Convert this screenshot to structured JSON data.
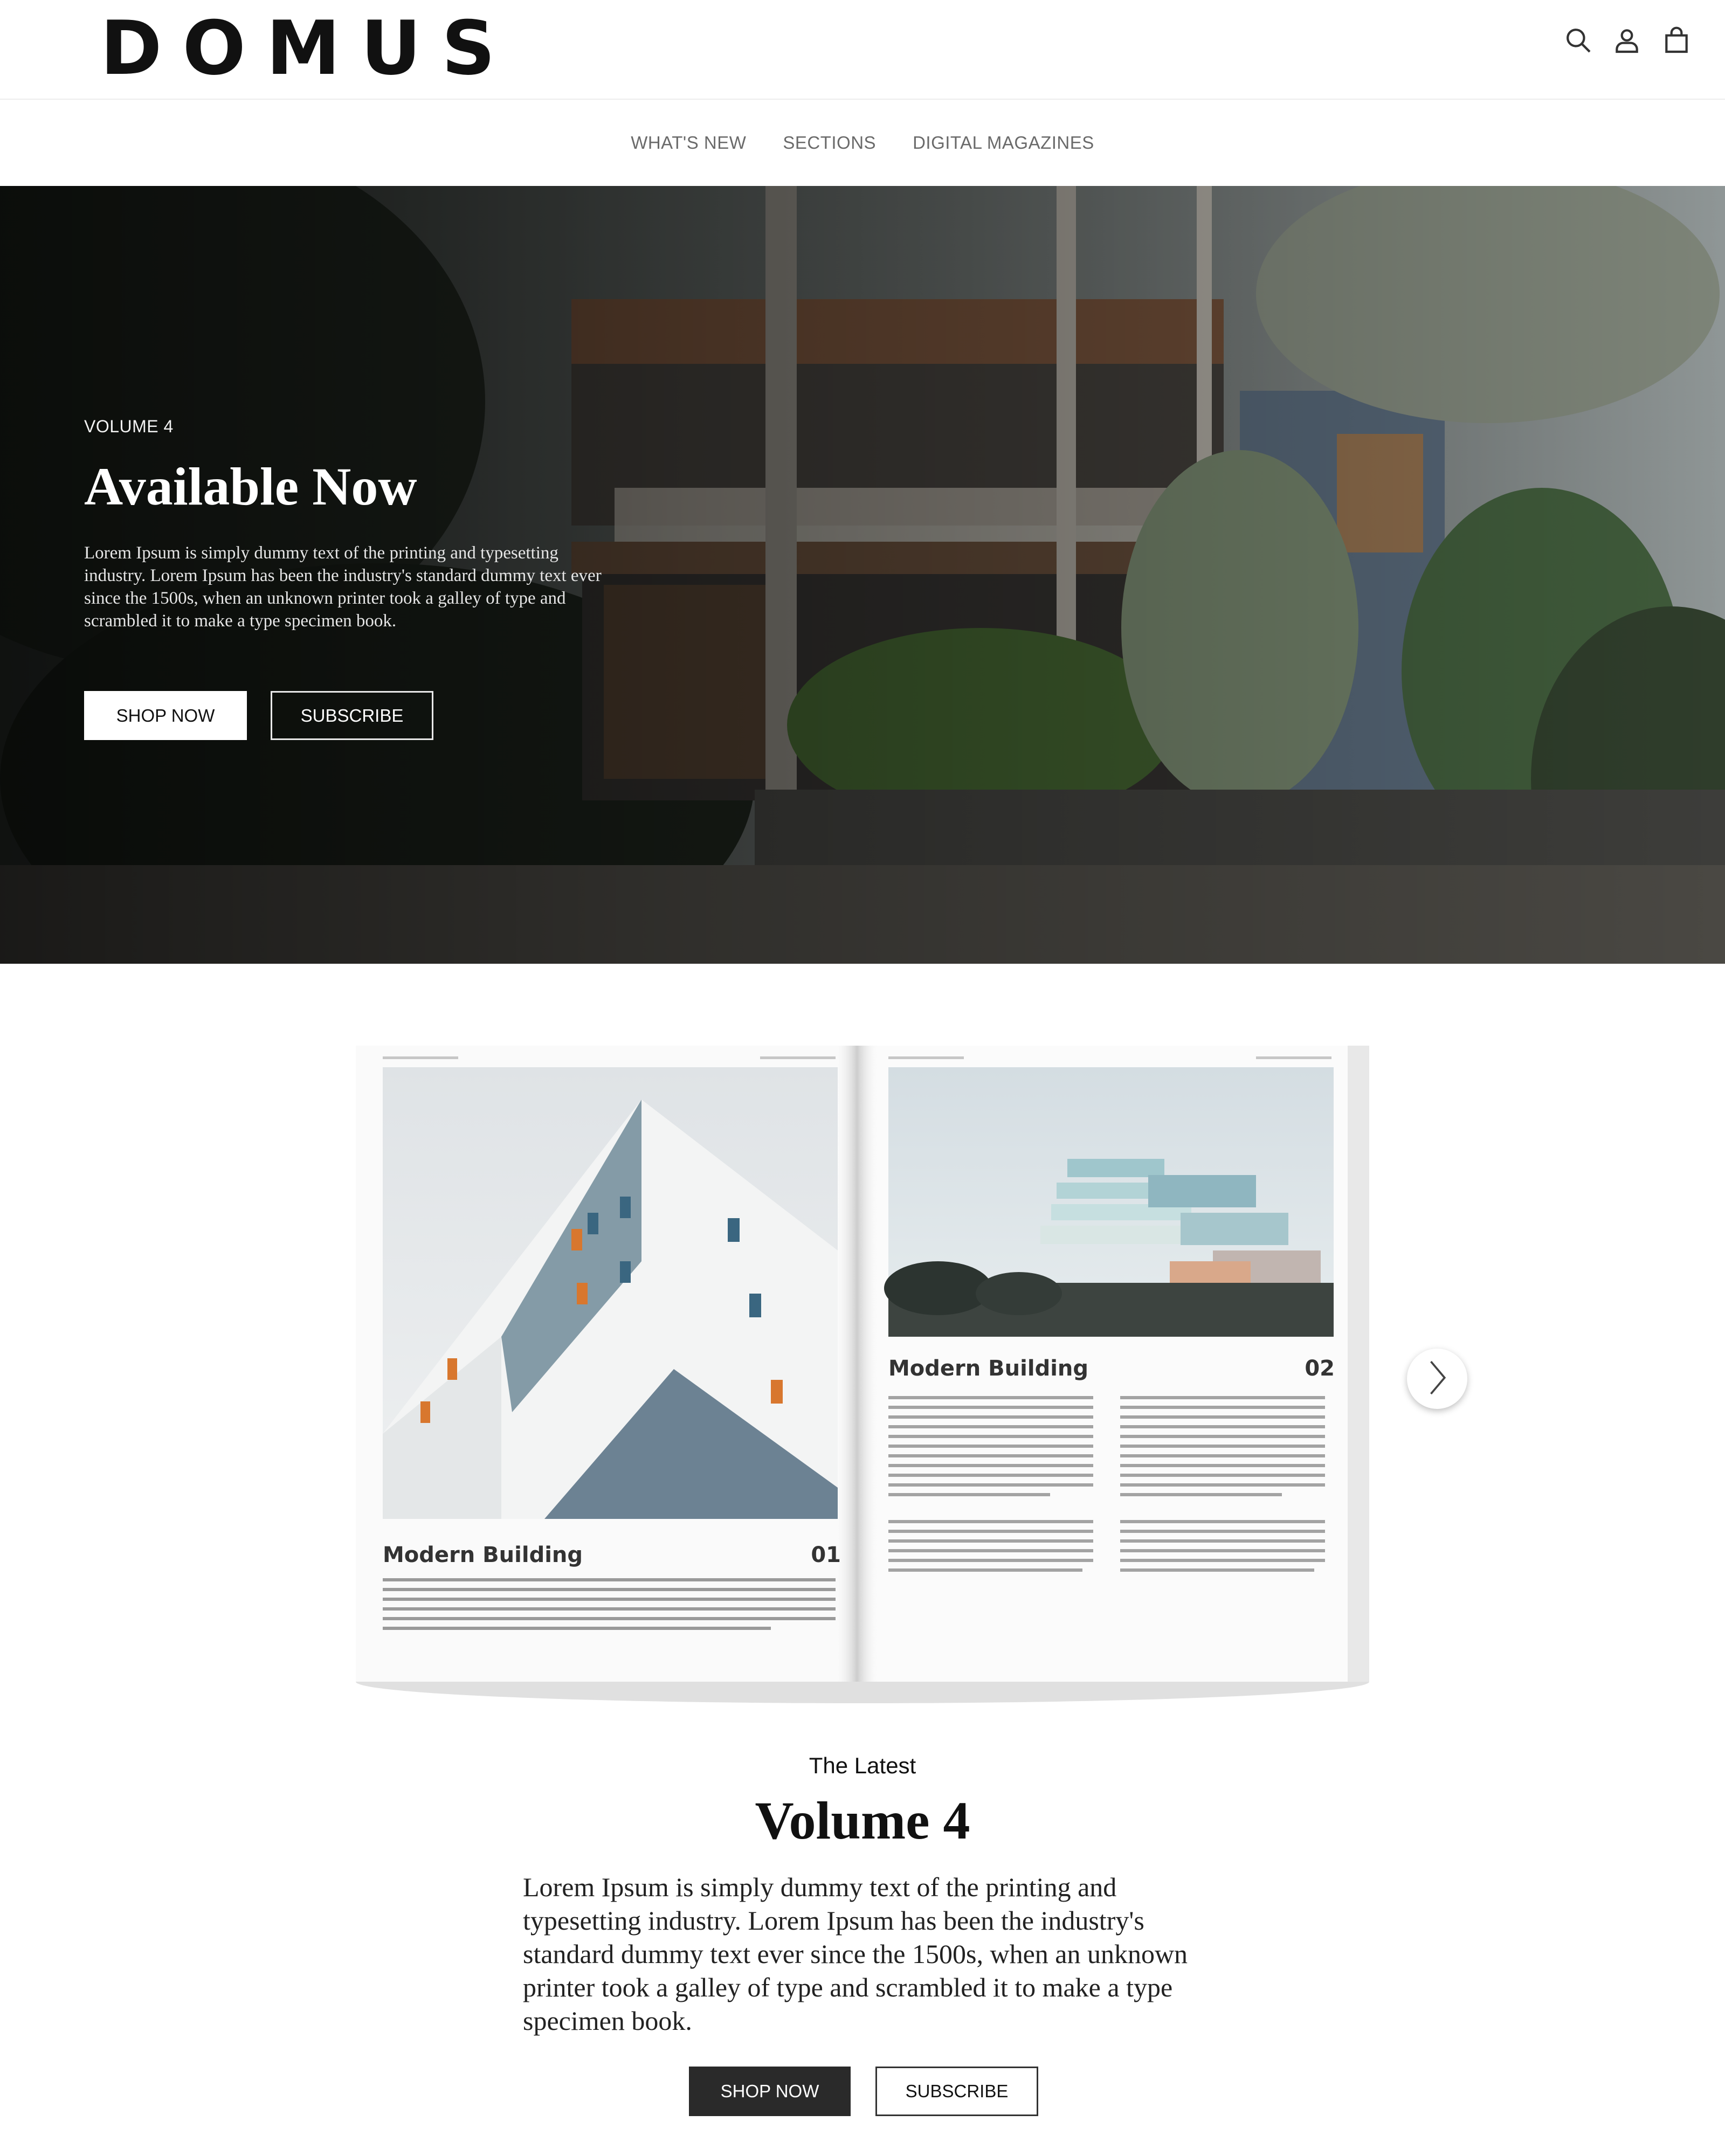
{
  "header": {
    "logo": "DOMUS",
    "icons": [
      "search-icon",
      "account-icon",
      "bag-icon"
    ]
  },
  "nav": {
    "items": [
      "WHAT'S NEW",
      "SECTIONS",
      "DIGITAL MAGAZINES"
    ]
  },
  "hero": {
    "eyebrow": "VOLUME 4",
    "title": "Available Now",
    "description": "Lorem Ipsum is simply dummy text of the printing and typesetting industry. Lorem Ipsum has been the industry's standard dummy text ever since the 1500s, when an unknown printer took a galley of type and scrambled it to make a type specimen book.",
    "shop_label": "SHOP NOW",
    "subscribe_label": "SUBSCRIBE"
  },
  "magazine": {
    "left_page": {
      "title": "Modern Building",
      "number": "01"
    },
    "right_page": {
      "title": "Modern Building",
      "number": "02"
    },
    "next_icon": "chevron-right-icon"
  },
  "latest": {
    "eyebrow": "The Latest",
    "title": "Volume 4",
    "description": "Lorem Ipsum is simply dummy text of the printing and typesetting industry. Lorem Ipsum has been the industry's standard dummy text ever since the 1500s, when an unknown printer took a galley of type and scrambled it to make a type specimen book.",
    "shop_label": "SHOP NOW",
    "subscribe_label": "SUBSCRIBE"
  },
  "colors": {
    "text": "#111111",
    "nav_text": "#6a6a6a",
    "dark_button": "#2a2a2a",
    "white": "#ffffff"
  }
}
